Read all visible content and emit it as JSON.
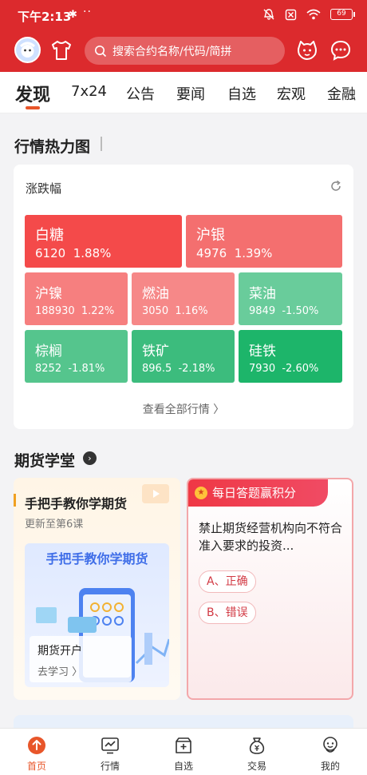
{
  "status_bar": {
    "time": "下午2:13",
    "bluetooth": "✱",
    "dots": "··",
    "battery": "69"
  },
  "header": {
    "search_placeholder": "搜索合约名称/代码/简拼"
  },
  "tabs": [
    {
      "label": "发现",
      "active": true
    },
    {
      "label": "7x24"
    },
    {
      "label": "公告"
    },
    {
      "label": "要闻"
    },
    {
      "label": "自选"
    },
    {
      "label": "宏观"
    },
    {
      "label": "金融"
    }
  ],
  "heatmap": {
    "section_title": "行情热力图",
    "metric_label": "涨跌幅",
    "view_all": "查看全部行情 〉",
    "tiles": [
      {
        "name": "白糖",
        "price": "6120",
        "change": "1.88%",
        "color": "#f44a4a"
      },
      {
        "name": "沪银",
        "price": "4976",
        "change": "1.39%",
        "color": "#f46f6f"
      },
      {
        "name": "沪镍",
        "price": "188930",
        "change": "1.22%",
        "color": "#f67f7f"
      },
      {
        "name": "燃油",
        "price": "3050",
        "change": "1.16%",
        "color": "#f68888"
      },
      {
        "name": "菜油",
        "price": "9849",
        "change": "-1.50%",
        "color": "#69cc9b"
      },
      {
        "name": "棕榈",
        "price": "8252",
        "change": "-1.81%",
        "color": "#55c58d"
      },
      {
        "name": "铁矿",
        "price": "896.5",
        "change": "-2.18%",
        "color": "#3cbc7d"
      },
      {
        "name": "硅铁",
        "price": "7930",
        "change": "-2.60%",
        "color": "#1db56a"
      }
    ]
  },
  "school": {
    "section_title": "期货学堂",
    "course": {
      "title": "手把手教你学期货",
      "subtitle": "更新至第6课",
      "banner_title": "手把手教你学期货",
      "lesson": "期货开户",
      "action": "去学习 〉"
    },
    "quiz": {
      "header": "每日答题赢积分",
      "question": "禁止期货经营机构向不符合准入要求的投资...",
      "option_a": "A、正确",
      "option_b": "B、错误"
    }
  },
  "bottom_nav": [
    {
      "label": "首页",
      "icon": "home-icon",
      "active": true
    },
    {
      "label": "行情",
      "icon": "chart-icon"
    },
    {
      "label": "自选",
      "icon": "watchlist-icon"
    },
    {
      "label": "交易",
      "icon": "trade-bag-icon"
    },
    {
      "label": "我的",
      "icon": "profile-icon"
    }
  ],
  "colors": {
    "brand_red": "#dc2a2d",
    "accent_orange": "#e8562a"
  }
}
